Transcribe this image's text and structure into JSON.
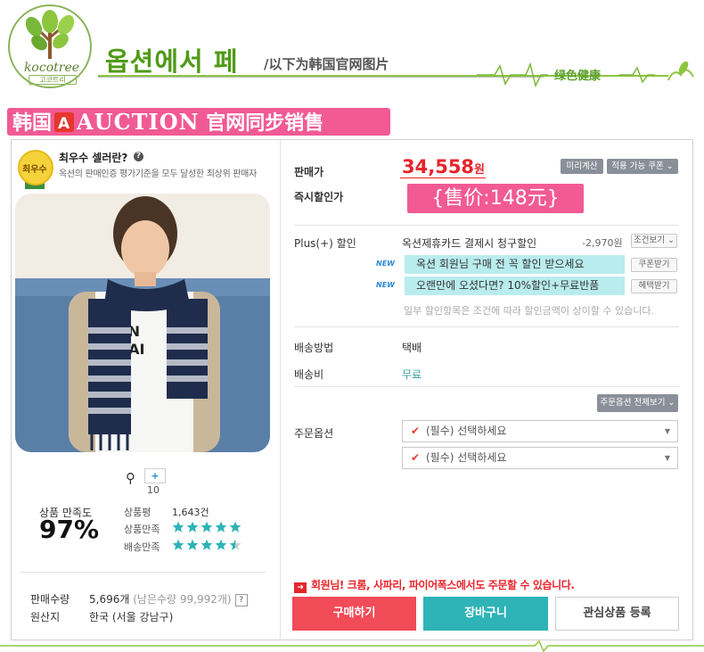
{
  "header": {
    "logo_text": "kocotree",
    "logo_sub": "고코트리",
    "title": "옵션에서 페",
    "subtitle": "/以下为韩国官网图片",
    "health_text": "绿色健康"
  },
  "promo": {
    "left": "韩国",
    "badge_letter": "A",
    "auction": "AUCTION",
    "right": "官网同步销售"
  },
  "badge": {
    "medal_text": "최우수",
    "title": "최우수 셀러란?",
    "help": "?",
    "desc": "옥션의 판매인증 평가기준을 모두 달성한 최상위 판매자"
  },
  "gallery": {
    "plus": "+",
    "count": "10",
    "shirt_text1": "BAN",
    "shirt_text2": "CHAI"
  },
  "reviews": {
    "sat_label": "상품 만족도",
    "sat_value": "97%",
    "count_label": "상품평",
    "count_value": "1,643건",
    "product_label": "상품만족",
    "product_rating": 5,
    "delivery_label": "배송만족",
    "delivery_rating": 4.5
  },
  "meta": {
    "sales_label": "판매수량",
    "sales_value": "5,696개",
    "sales_remaining": "(남은수량 99,992개)",
    "sales_help": "?",
    "origin_label": "원산지",
    "origin_value": "한국 (서울 강남구)"
  },
  "price": {
    "label": "판매가",
    "value": "34,558",
    "unit": "원",
    "calc_button": "미리계산",
    "coupon_button": "적용 가능 쿠폰 ⌄",
    "instant_label": "즉시할인가",
    "sale_text": "{售价:148元}"
  },
  "plus_discount": {
    "label": "Plus(+) 할인",
    "card_desc": "옥션제휴카드 결제시 청구할인",
    "card_amount": "-2,970원",
    "condition_button": "조건보기 ⌄",
    "new_tag": "NEW",
    "offer1": "옥션 회원님 구매 전 꼭 할인 받으세요",
    "offer1_button": "쿠폰받기",
    "offer2": "오랜만에 오셨다면? 10%할인+무료반품",
    "offer2_button": "혜택받기",
    "note": "일부 할인항목은 조건에 따라 할인금액이 상이할 수 있습니다."
  },
  "shipping": {
    "method_label": "배송방법",
    "method_value": "택배",
    "fee_label": "배송비",
    "fee_value": "무료"
  },
  "options": {
    "view_all_button": "주문옵션 전체보기 ⌄",
    "label": "주문옵션",
    "select1": "(필수) 선택하세요",
    "select2": "(필수) 선택하세요"
  },
  "actions": {
    "notice": "회원님! 크롬, 사파리, 파이어폭스에서도 주문할 수 있습니다.",
    "buy": "구매하기",
    "cart": "장바구니",
    "wish": "관심상품 등록"
  },
  "colors": {
    "accent_red": "#e8242b",
    "promo_pink": "#f15a94",
    "teal": "#2eb3b7",
    "brand_green": "#4f9a16"
  }
}
